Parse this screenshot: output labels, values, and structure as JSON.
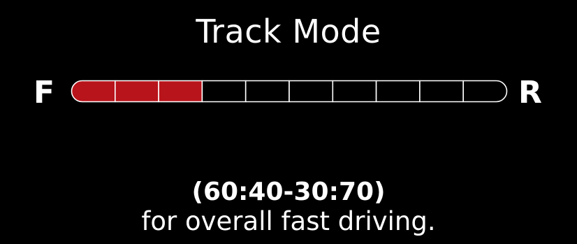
{
  "mode_title": "Track Mode",
  "labels": {
    "front": "F",
    "rear": "R"
  },
  "torque_bar": {
    "total_segments": 10,
    "filled_segments": 3,
    "fill_color": "#b8141b",
    "empty_color": "#000000",
    "outline_color": "#ffffff"
  },
  "ratio_text": "(60:40-30:70)",
  "description": "for overall fast driving."
}
